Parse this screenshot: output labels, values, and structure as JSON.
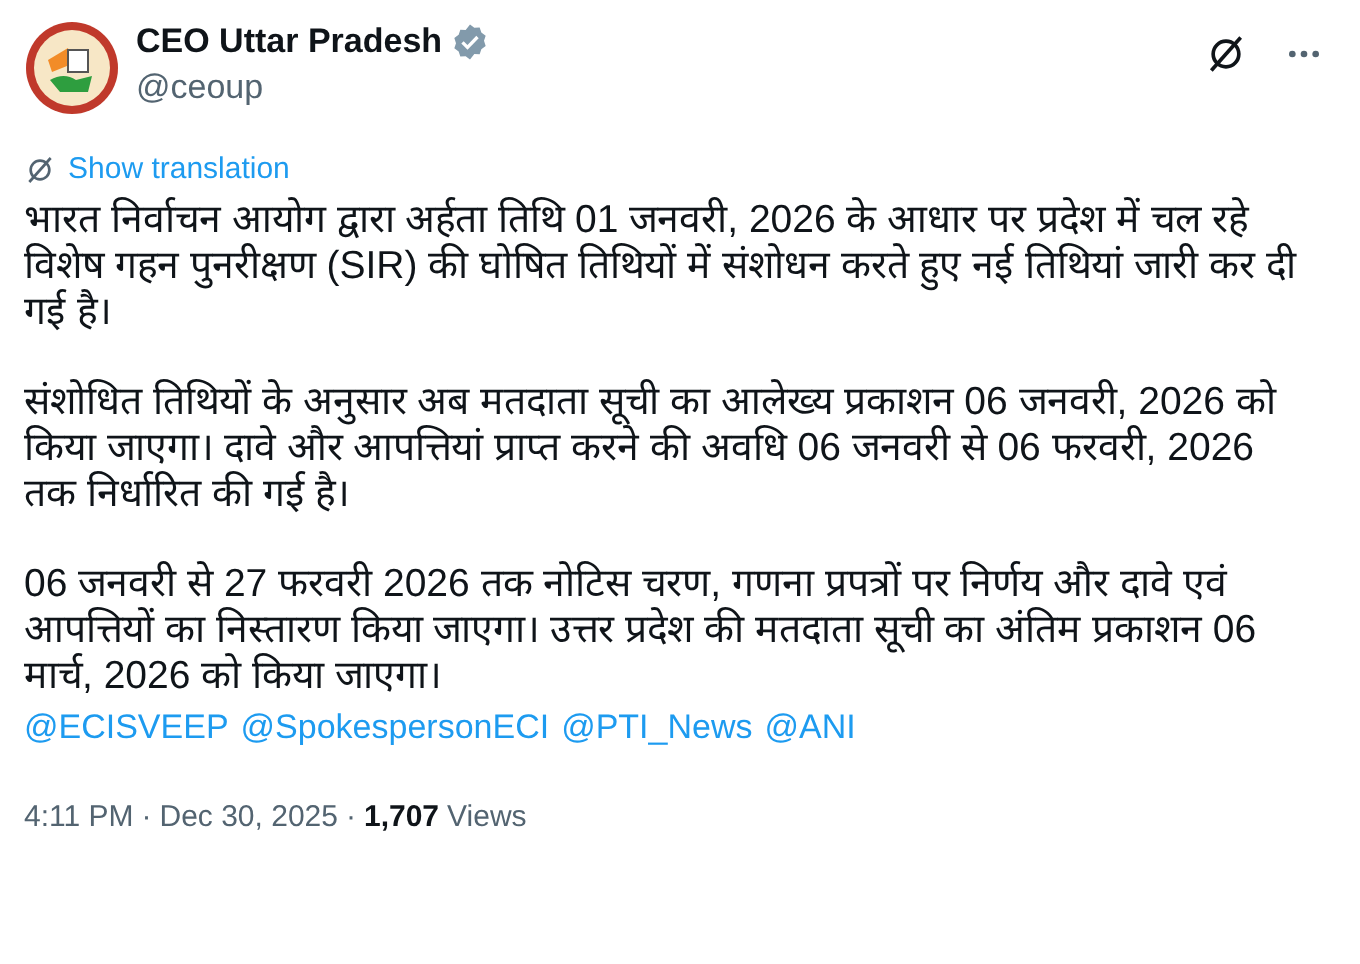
{
  "author": {
    "name": "CEO Uttar Pradesh",
    "handle": "@ceoup",
    "verified": true
  },
  "translate_link": "Show translation",
  "paragraphs": [
    "भारत निर्वाचन आयोग द्वारा अर्हता तिथि 01 जनवरी, 2026 के आधार पर प्रदेश में चल रहे विशेष गहन पुनरीक्षण (SIR) की घोषित तिथियों में संशोधन करते हुए नई तिथियां जारी कर दी गई है।",
    "संशोधित तिथियों के अनुसार अब मतदाता सूची का आलेख्य प्रकाशन 06 जनवरी, 2026 को किया जाएगा। दावे और आपत्तियां प्राप्त करने की अवधि 06 जनवरी से 06 फरवरी, 2026 तक निर्धारित की गई है।",
    "06 जनवरी से 27 फरवरी 2026 तक नोटिस चरण, गणना प्रपत्रों पर निर्णय और दावे एवं आपत्तियों का निस्तारण किया जाएगा। उत्तर प्रदेश की मतदाता सूची का अंतिम प्रकाशन 06 मार्च, 2026 को किया जाएगा।"
  ],
  "mentions": [
    "@ECISVEEP",
    "@SpokespersonECI",
    "@PTI_News",
    "@ANI"
  ],
  "meta": [
    "4:11 PM",
    "·",
    "Dec 30, 2025",
    "·"
  ],
  "views": {
    "count": "1,707",
    "label": "Views"
  }
}
